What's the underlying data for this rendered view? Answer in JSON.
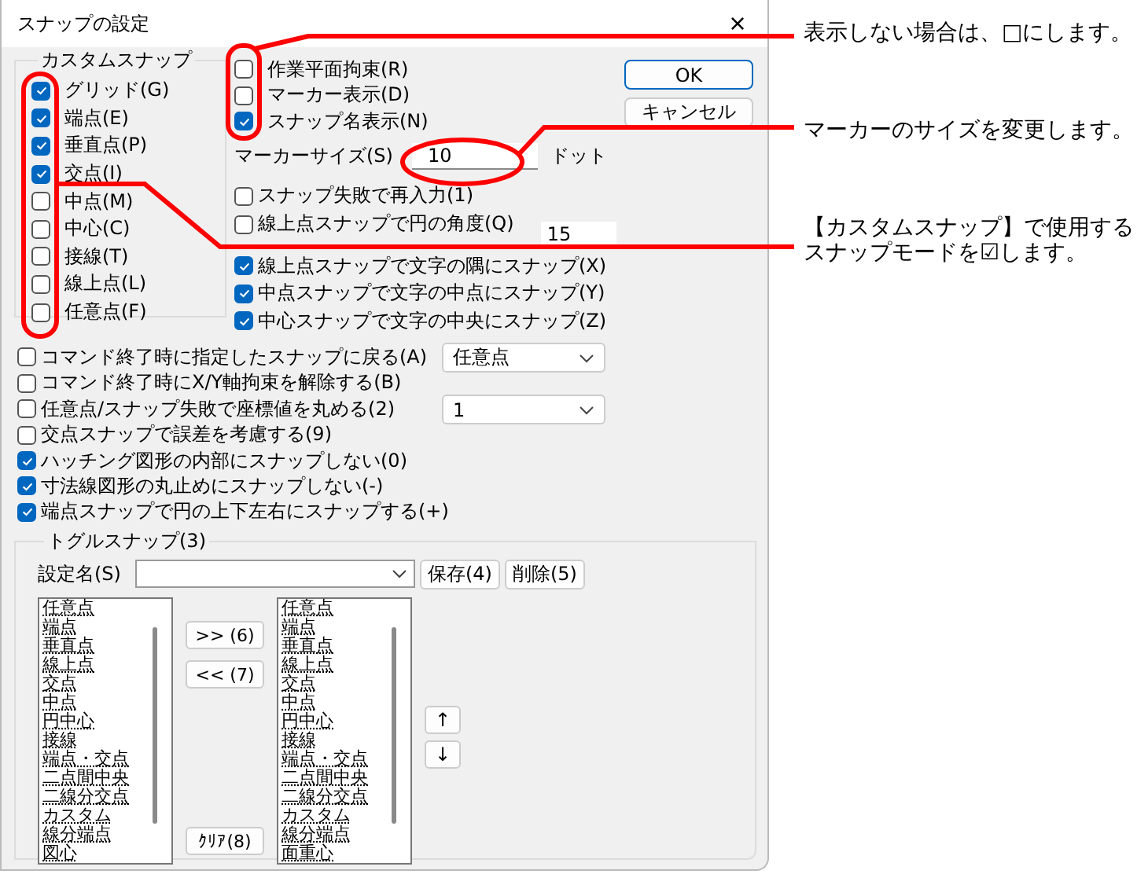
{
  "window": {
    "title": "スナップの設定",
    "close": "×"
  },
  "custom_snap": {
    "title": "カスタムスナップ",
    "items": [
      {
        "label": "グリッド(G)",
        "checked": true
      },
      {
        "label": "端点(E)",
        "checked": true
      },
      {
        "label": "垂直点(P)",
        "checked": true
      },
      {
        "label": "交点(I)",
        "checked": true
      },
      {
        "label": "中点(M)",
        "checked": false
      },
      {
        "label": "中心(C)",
        "checked": false
      },
      {
        "label": "接線(T)",
        "checked": false
      },
      {
        "label": "線上点(L)",
        "checked": false
      },
      {
        "label": "任意点(F)",
        "checked": false
      }
    ]
  },
  "display_options": [
    {
      "label": "作業平面拘束(R)",
      "checked": false
    },
    {
      "label": "マーカー表示(D)",
      "checked": false
    },
    {
      "label": "スナップ名表示(N)",
      "checked": true
    }
  ],
  "buttons": [
    "OK",
    "キャンセル"
  ],
  "marker_size": {
    "label": "マーカーサイズ(S)",
    "value": "10",
    "unit": "ドット"
  },
  "retry_options": [
    {
      "label": "スナップ失敗で再入力(1)",
      "checked": false
    },
    {
      "label": "線上点スナップで円の角度(Q)",
      "checked": false,
      "value": "15"
    }
  ],
  "text_options": [
    {
      "label": "線上点スナップで文字の隅にスナップ(X)",
      "checked": true
    },
    {
      "label": "中点スナップで文字の中点にスナップ(Y)",
      "checked": true
    },
    {
      "label": "中心スナップで文字の中央にスナップ(Z)",
      "checked": true
    }
  ],
  "command_options": [
    {
      "label": "コマンド終了時に指定したスナップに戻る(A)",
      "checked": false,
      "dropdown": "任意点"
    },
    {
      "label": "コマンド終了時にX/Y軸拘束を解除する(B)",
      "checked": false
    },
    {
      "label": "任意点/スナップ失敗で座標値を丸める(2)",
      "checked": false,
      "dropdown": "1"
    },
    {
      "label": "交点スナップで誤差を考慮する(9)",
      "checked": false
    },
    {
      "label": "ハッチング図形の内部にスナップしない(0)",
      "checked": true
    },
    {
      "label": "寸法線図形の丸止めにスナップしない(-)",
      "checked": true
    },
    {
      "label": "端点スナップで円の上下左右にスナップする(+)",
      "checked": true
    }
  ],
  "toggle_snap": {
    "title": "トグルスナップ(3)",
    "setting_label": "設定名(S)",
    "save": "保存(4)",
    "delete": "削除(5)",
    "left_list": [
      "任意点",
      "端点",
      "垂直点",
      "線上点",
      "交点",
      "中点",
      "円中心",
      "接線",
      "端点・交点",
      "二点間中央",
      "二線分交点",
      "カスタム",
      "線分端点",
      "図心"
    ],
    "add": ">> (6)",
    "remove": "<< (7)",
    "clear": "ｸﾘｱ(8)",
    "right_list": [
      "任意点",
      "端点",
      "垂直点",
      "線上点",
      "交点",
      "中点",
      "円中心",
      "接線",
      "端点・交点",
      "二点間中央",
      "二線分交点",
      "カスタム",
      "線分端点",
      "面重心"
    ],
    "up": "↑",
    "down": "↓"
  },
  "annotations": [
    {
      "lines": [
        "表示しない場合は、□にします。"
      ]
    },
    {
      "lines": [
        "マーカーのサイズを変更します。"
      ]
    },
    {
      "lines": [
        "【カスタムスナップ】で使用する",
        "スナップモードを☑します。"
      ]
    }
  ]
}
